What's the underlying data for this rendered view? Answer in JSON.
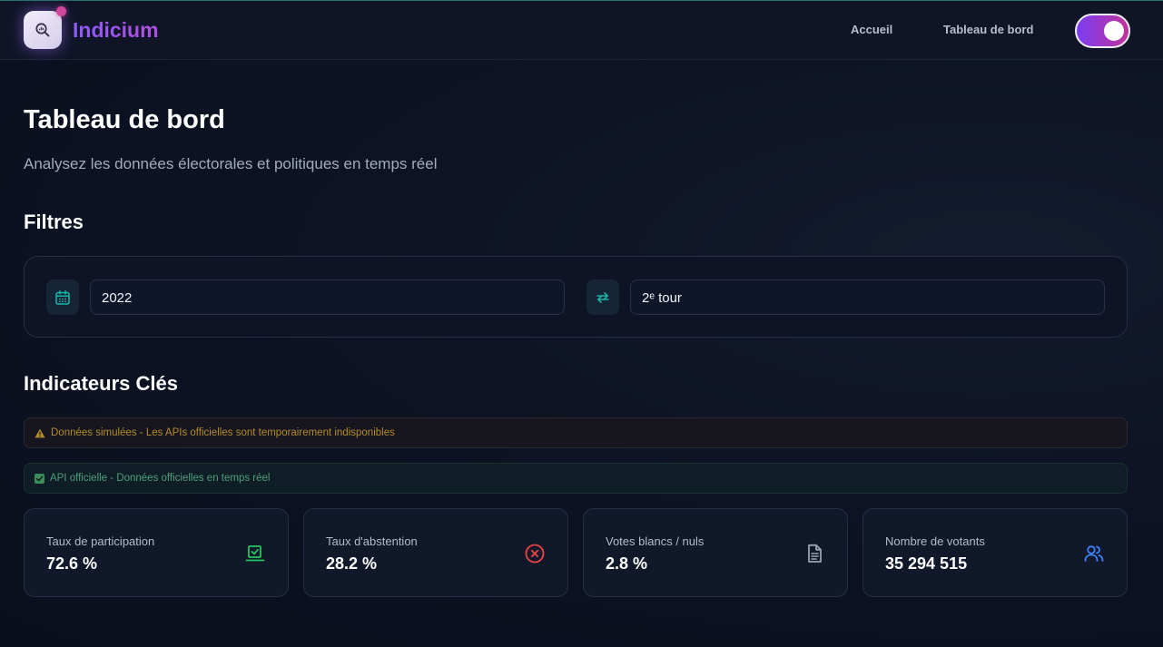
{
  "header": {
    "brand": "Indicium",
    "nav": [
      {
        "label": "Accueil"
      },
      {
        "label": "Tableau de bord"
      }
    ],
    "theme_toggle": {
      "state": "on"
    }
  },
  "page": {
    "title": "Tableau de bord",
    "subtitle": "Analysez les données électorales et politiques en temps réel"
  },
  "filters": {
    "title": "Filtres",
    "year": {
      "value": "2022",
      "icon": "calendar-icon"
    },
    "round": {
      "value": "2ᵉ tour",
      "icon": "swap-arrows-icon"
    }
  },
  "indicators": {
    "title": "Indicateurs Clés",
    "banners": {
      "warning": "Données simulées - Les APIs officielles sont temporairement indisponibles",
      "official": "API officielle - Données officielles en temps réel"
    },
    "cards": [
      {
        "label": "Taux de participation",
        "value": "72.6 %",
        "icon": "vote-check-icon",
        "color": "#22c55e"
      },
      {
        "label": "Taux d'abstention",
        "value": "28.2 %",
        "icon": "x-circle-icon",
        "color": "#ef4444"
      },
      {
        "label": "Votes blancs / nuls",
        "value": "2.8 %",
        "icon": "document-icon",
        "color": "#9ca3af"
      },
      {
        "label": "Nombre de votants",
        "value": "35 294 515",
        "icon": "users-icon",
        "color": "#3b82f6"
      }
    ]
  },
  "colors": {
    "accent_purple": "#8a5cf6",
    "accent_pink": "#c0329a",
    "teal": "#14b8a6",
    "warning": "#b28c2c",
    "success": "#4f9f7b"
  }
}
